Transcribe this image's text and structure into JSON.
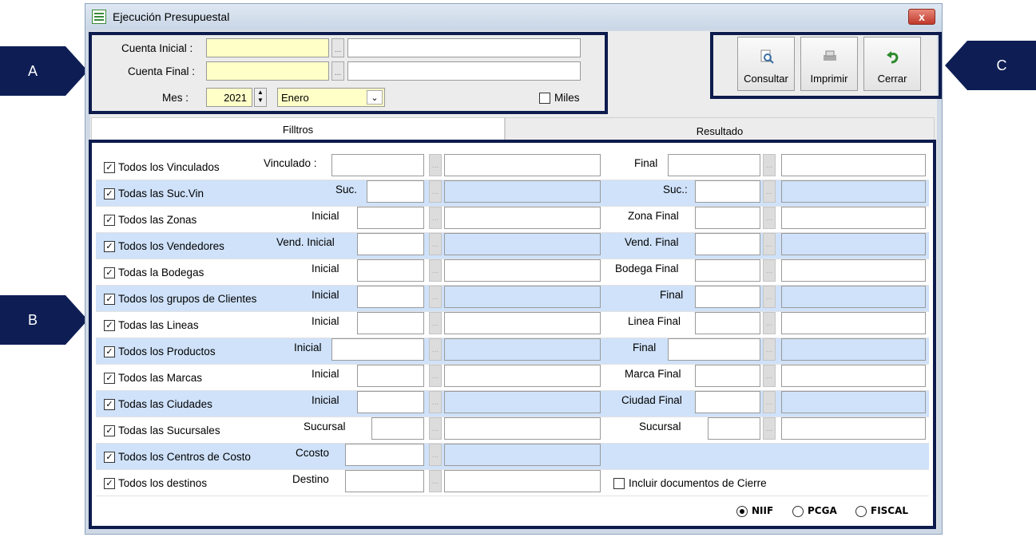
{
  "window": {
    "title": "Ejecución Presupuestal",
    "close_glyph": "x"
  },
  "callouts": {
    "a": "A",
    "b": "B",
    "c": "C"
  },
  "account": {
    "initial_label": "Cuenta Inicial :",
    "final_label": "Cuenta Final :",
    "month_label": "Mes :",
    "year_value": "2021",
    "month_value": "Enero",
    "thousands_label": "Miles",
    "dots": "..."
  },
  "toolbar": {
    "consultar": "Consultar",
    "imprimir": "Imprimir",
    "cerrar": "Cerrar"
  },
  "tabs": {
    "filters": "Filltros",
    "result": "Resultado"
  },
  "filters": [
    {
      "check_label": "Todos los Vinculados",
      "mid_label": "Vinculado :",
      "right_label": "Final"
    },
    {
      "check_label": "Todas las Suc.Vin",
      "mid_label": "Suc.",
      "right_label": "Suc.:"
    },
    {
      "check_label": "Todos las Zonas",
      "mid_label": "Inicial",
      "right_label": "Zona Final"
    },
    {
      "check_label": "Todos los Vendedores",
      "mid_label": "Vend. Inicial",
      "right_label": "Vend. Final"
    },
    {
      "check_label": "Todas la Bodegas",
      "mid_label": "Inicial",
      "right_label": "Bodega Final"
    },
    {
      "check_label": "Todos los grupos de Clientes",
      "mid_label": "Inicial",
      "right_label": "Final"
    },
    {
      "check_label": "Todas las Lineas",
      "mid_label": "Inicial",
      "right_label": "Linea Final"
    },
    {
      "check_label": "Todos los Productos",
      "mid_label": "Inicial",
      "right_label": "Final"
    },
    {
      "check_label": "Todos las Marcas",
      "mid_label": "Inicial",
      "right_label": "Marca Final"
    },
    {
      "check_label": "Todas las Ciudades",
      "mid_label": "Inicial",
      "right_label": "Ciudad Final"
    },
    {
      "check_label": "Todas las Sucursales",
      "mid_label": "Sucursal",
      "right_label": "Sucursal"
    },
    {
      "check_label": "Todos los Centros de Costo",
      "mid_label": "Ccosto"
    },
    {
      "check_label": "Todos los destinos",
      "mid_label": "Destino",
      "extra_check": "Incluir documentos de Cierre"
    }
  ],
  "accounting_standard": {
    "options": [
      "NIIF",
      "PCGA",
      "FISCAL"
    ],
    "selected": "NIIF"
  },
  "check_glyph": "✓",
  "colors": {
    "callout": "#0e1e55",
    "row_alt": "#cfe2fa",
    "yellow_input": "#ffffc8"
  }
}
